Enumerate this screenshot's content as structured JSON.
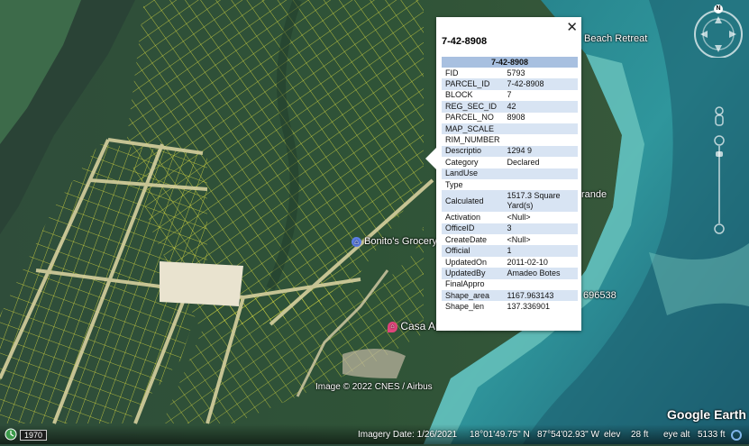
{
  "map": {
    "place_labels": {
      "beach_retreat": "Beach Retreat",
      "grande": "rande",
      "bonito": "Bonito's Grocery S",
      "number": "696538",
      "casa": "Casa Aura Maria"
    },
    "image_credit": "Image © 2022 CNES / Airbus",
    "brand": "Google Earth"
  },
  "popup": {
    "title": "7-42-8908",
    "table_header": "7-42-8908",
    "rows": [
      {
        "k": "FID",
        "v": "5793"
      },
      {
        "k": "PARCEL_ID",
        "v": "7-42-8908"
      },
      {
        "k": "BLOCK",
        "v": "7"
      },
      {
        "k": "REG_SEC_ID",
        "v": "42"
      },
      {
        "k": "PARCEL_NO",
        "v": "8908"
      },
      {
        "k": "MAP_SCALE",
        "v": ""
      },
      {
        "k": "RIM_NUMBER",
        "v": ""
      },
      {
        "k": "Descriptio",
        "v": "1294 9"
      },
      {
        "k": "Category",
        "v": "Declared"
      },
      {
        "k": "LandUse",
        "v": ""
      },
      {
        "k": "Type",
        "v": ""
      },
      {
        "k": "Calculated",
        "v": "1517.3 Square Yard(s)"
      },
      {
        "k": "Activation",
        "v": "<Null>"
      },
      {
        "k": "OfficeID",
        "v": "3"
      },
      {
        "k": "CreateDate",
        "v": "<Null>"
      },
      {
        "k": "Official",
        "v": "1"
      },
      {
        "k": "UpdatedOn",
        "v": "2011-02-10"
      },
      {
        "k": "UpdatedBy",
        "v": "Amadeo Botes"
      },
      {
        "k": "FinalAppro",
        "v": ""
      },
      {
        "k": "Shape_area",
        "v": "1167.963143"
      },
      {
        "k": "Shape_len",
        "v": "137.336901"
      }
    ]
  },
  "status": {
    "year": "1970",
    "imagery_date": "Imagery Date: 1/26/2021",
    "lat": "18°01'49.75\" N",
    "lon": "87°54'02.93\" W",
    "elev_label": "elev",
    "elev": "28 ft",
    "eye_alt_label": "eye alt",
    "eye_alt": "5133 ft"
  },
  "nav": {
    "north": "N"
  },
  "colors": {
    "parcel_lines": "#e8e640",
    "popup_header": "#a8c0e0",
    "popup_alt_row": "#d8e4f3",
    "sea": "#2f8e96"
  }
}
